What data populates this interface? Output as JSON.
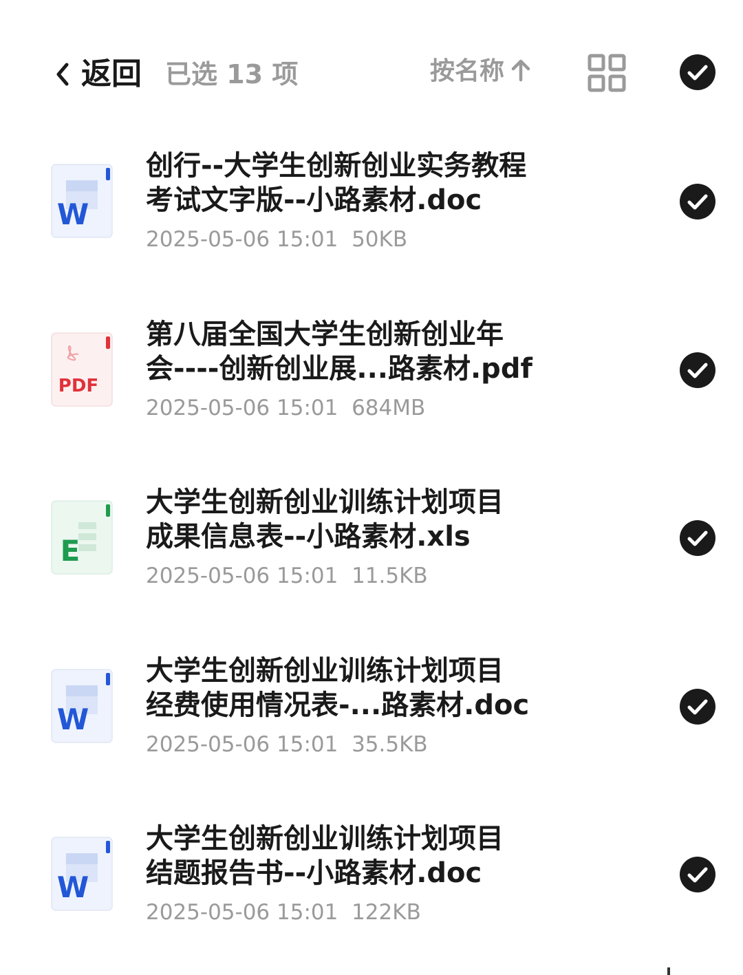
{
  "header": {
    "back_label": "返回",
    "selected_count_label": "已选 13 项",
    "sort_label": "按名称",
    "icons": {
      "back": "chevron-left-icon",
      "sort_direction": "arrow-up-icon",
      "view_mode": "grid-view-icon",
      "select_all": "check-circle-icon"
    }
  },
  "files": [
    {
      "type": "doc",
      "icon_letter": "W",
      "name": "创行--大学生创新创业实务教程\n考试文字版--小路素材.doc",
      "date": "2025-05-06 15:01",
      "size": "50KB",
      "selected": true
    },
    {
      "type": "pdf",
      "icon_letter": "PDF",
      "name": "第八届全国大学生创新创业年\n会----创新创业展...路素材.pdf",
      "date": "2025-05-06 15:01",
      "size": "684MB",
      "selected": true
    },
    {
      "type": "xls",
      "icon_letter": "E",
      "name": "大学生创新创业训练计划项目\n成果信息表--小路素材.xls",
      "date": "2025-05-06 15:01",
      "size": "11.5KB",
      "selected": true
    },
    {
      "type": "doc",
      "icon_letter": "W",
      "name": "大学生创新创业训练计划项目\n经费使用情况表-...路素材.doc",
      "date": "2025-05-06 15:01",
      "size": "35.5KB",
      "selected": true
    },
    {
      "type": "doc",
      "icon_letter": "W",
      "name": "大学生创新创业训练计划项目\n结题报告书--小路素材.doc",
      "date": "2025-05-06 15:01",
      "size": "122KB",
      "selected": true
    }
  ],
  "colors": {
    "doc_accent": "#2257d6",
    "doc_bg": "#eef3fd",
    "pdf_accent": "#e0323a",
    "pdf_bg": "#fdf0f0",
    "xls_accent": "#1e9b4f",
    "xls_bg": "#ecf7f0",
    "check_bg": "#1a1a1a",
    "muted_text": "#9a9a9a"
  }
}
